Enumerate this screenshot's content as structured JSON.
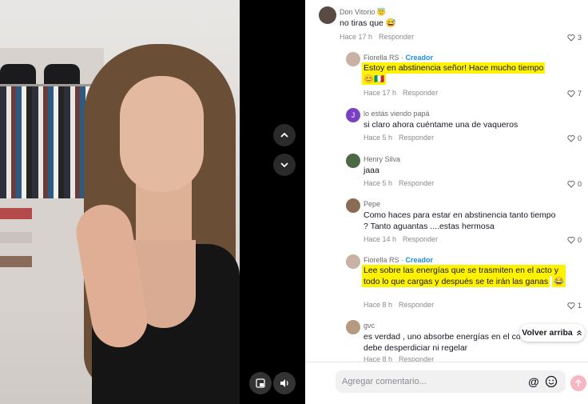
{
  "comments": [
    {
      "user": "Don Vitorio 😇",
      "creator": "",
      "text_lines": [
        "no tiras que 😅"
      ],
      "time": "Hace 17 h",
      "reply": "Responder",
      "likes": "3",
      "highlight": false
    },
    {
      "user": "Fiorella RS · ",
      "creator": "Creador",
      "text_lines": [
        "Estoy en abstinencia señor! Hace mucho tiempo",
        "😊🇮🇹"
      ],
      "time": "Hace 17 h",
      "reply": "Responder",
      "likes": "7",
      "highlight": true
    },
    {
      "user": "lo estás viendo papá",
      "creator": "",
      "text_lines": [
        "si claro ahora cuéntame una de vaqueros"
      ],
      "time": "Hace 5 h",
      "reply": "Responder",
      "likes": "0",
      "highlight": false
    },
    {
      "user": "Henry Silva",
      "creator": "",
      "text_lines": [
        "jaaa"
      ],
      "time": "Hace 5 h",
      "reply": "Responder",
      "likes": "0",
      "highlight": false
    },
    {
      "user": "Pepe",
      "creator": "",
      "text_lines": [
        "Como haces para estar en abstinencia tanto tiempo",
        "? Tanto aguantas ....estas hermosa"
      ],
      "time": "Hace 14 h",
      "reply": "Responder",
      "likes": "0",
      "highlight": false
    },
    {
      "user": "Fiorella RS · ",
      "creator": "Creador",
      "text_lines": [
        "Lee sobre las energías que se trasmiten en el acto y",
        "todo lo que cargas y después se te irán las ganas",
        "😂"
      ],
      "time": "Hace 8 h",
      "reply": "Responder",
      "likes": "1",
      "highlight": true
    },
    {
      "user": "gvc",
      "creator": "",
      "text_lines": [
        "es verdad , uno absorbe energías en el co",
        "debe desperdiciar ni regelar"
      ],
      "time": "Hace 8 h",
      "reply": "Responder",
      "likes": "",
      "highlight": false
    }
  ],
  "back_to_top": "Volver arriba",
  "comment_placeholder": "Agregar comentario...",
  "icons": {
    "nav_up": "chevron-up-icon",
    "nav_down": "chevron-down-icon",
    "like": "heart-icon",
    "mention": "at-icon",
    "emoji": "emoji-icon",
    "send": "arrow-up-icon",
    "sound": "speaker-icon",
    "pip": "picture-in-picture-icon"
  },
  "colors": {
    "creator": "#1a8fe3",
    "highlight": "#fff200",
    "send_button": "#f6b6c3"
  }
}
